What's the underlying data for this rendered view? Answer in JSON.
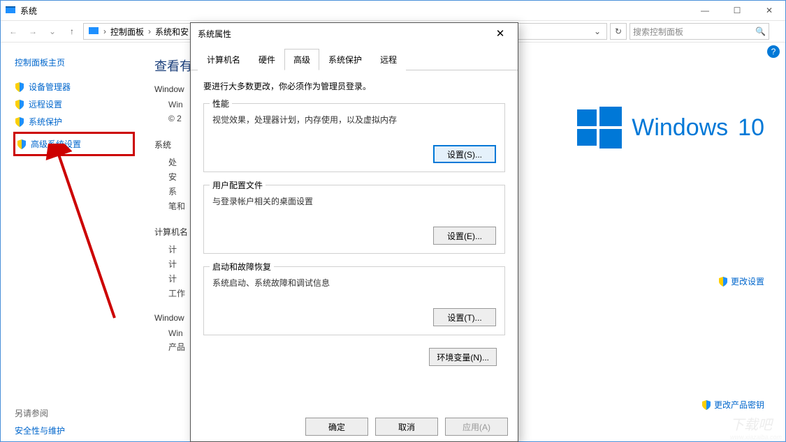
{
  "window": {
    "title": "系统",
    "breadcrumbs": [
      "控制面板",
      "系统和安"
    ],
    "search_placeholder": "搜索控制面板",
    "btn_min": "—",
    "btn_max": "☐",
    "btn_close": "✕"
  },
  "sidebar": {
    "home": "控制面板主页",
    "items": [
      {
        "label": "设备管理器"
      },
      {
        "label": "远程设置"
      },
      {
        "label": "系统保护"
      },
      {
        "label": "高级系统设置",
        "highlight": true
      }
    ],
    "see_also_heading": "另请参阅",
    "see_also": "安全性与维护"
  },
  "content": {
    "heading": "查看有",
    "win_edition": "Window",
    "rows": [
      "Win",
      "© 2"
    ],
    "sys_heading": "系统",
    "sys_rows": [
      "处",
      "安",
      "系",
      "笔和"
    ],
    "name_heading": "计算机名",
    "name_rows": [
      "计",
      "计",
      "计",
      "工作"
    ],
    "act_heading": "Window",
    "act_rows": [
      "Win",
      "产品"
    ],
    "logo_text_1": "Windows",
    "logo_text_2": "10",
    "change_settings": "更改设置",
    "change_key": "更改产品密钥",
    "help": "?"
  },
  "dialog": {
    "title": "系统属性",
    "tabs": [
      "计算机名",
      "硬件",
      "高级",
      "系统保护",
      "远程"
    ],
    "active_tab": 2,
    "admin_note": "要进行大多数更改，你必须作为管理员登录。",
    "groups": [
      {
        "legend": "性能",
        "desc": "视觉效果，处理器计划，内存使用，以及虚拟内存",
        "btn": "设置(S)..."
      },
      {
        "legend": "用户配置文件",
        "desc": "与登录帐户相关的桌面设置",
        "btn": "设置(E)..."
      },
      {
        "legend": "启动和故障恢复",
        "desc": "系统启动、系统故障和调试信息",
        "btn": "设置(T)..."
      }
    ],
    "env_btn": "环境变量(N)...",
    "ok": "确定",
    "cancel": "取消",
    "apply": "应用(A)"
  },
  "watermark": {
    "big": "下载吧",
    "small": "www.xiazaiba.com"
  }
}
